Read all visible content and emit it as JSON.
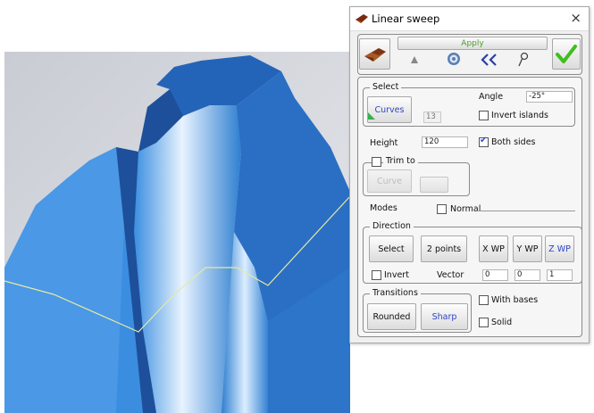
{
  "window": {
    "title": "Linear sweep",
    "close_symbol": "×"
  },
  "toolbar": {
    "apply_label": "Apply",
    "icons": [
      "profile-shape-icon",
      "triangle-tool-icon",
      "settings-gear-icon",
      "double-chevron-left-icon",
      "magnifier-icon",
      "checkmark-icon"
    ]
  },
  "select": {
    "group_label": "Select",
    "curves_button": "Curves",
    "count": "13",
    "angle_label": "Angle",
    "angle_value": "-25°",
    "invert_islands_label": "Invert islands",
    "invert_islands_checked": false
  },
  "height": {
    "label": "Height",
    "value": "120",
    "both_sides_label": "Both sides",
    "both_sides_checked": true
  },
  "trim": {
    "label": "Trim to",
    "checked": false,
    "curve_button": "Curve"
  },
  "modes": {
    "label": "Modes",
    "normal_label": "Normal",
    "normal_checked": false
  },
  "direction": {
    "label": "Direction",
    "select_button": "Select",
    "two_points_button": "2 points",
    "xwp_button": "X WP",
    "ywp_button": "Y WP",
    "zwp_button": "Z WP",
    "invert_label": "Invert",
    "invert_checked": false,
    "vector_label": "Vector",
    "vector": [
      "0",
      "0",
      "1"
    ]
  },
  "transitions": {
    "label": "Transitions",
    "rounded_button": "Rounded",
    "sharp_button": "Sharp"
  },
  "with_bases_label": "With bases",
  "with_bases_checked": false,
  "solid_label": "Solid",
  "solid_checked": false,
  "colors": {
    "accent": "#2f45c8",
    "check_green": "#3fbf1f",
    "surface_blue": "#2f7fd0"
  }
}
